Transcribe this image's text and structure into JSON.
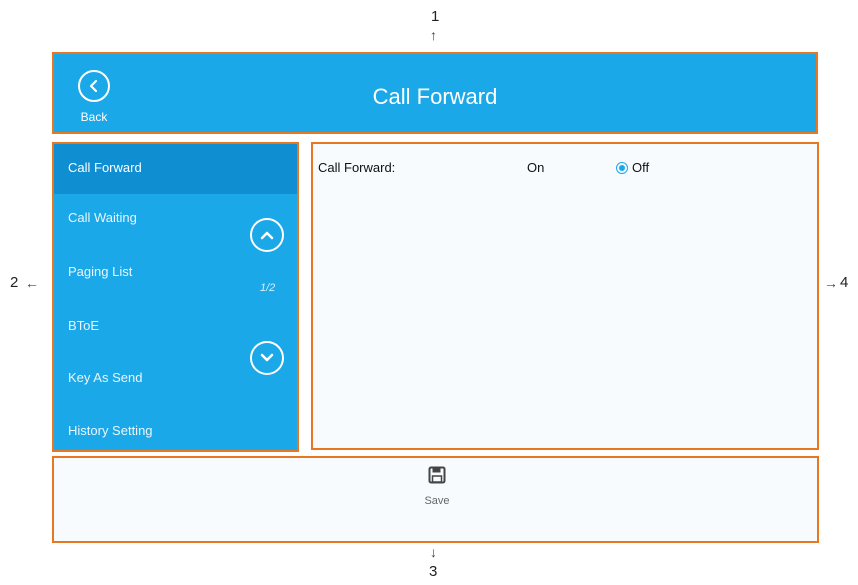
{
  "callouts": {
    "c1": "1",
    "c2": "2",
    "c3": "3",
    "c4": "4"
  },
  "header": {
    "back_label": "Back",
    "title": "Call Forward"
  },
  "sidebar": {
    "items": [
      {
        "label": "Call Forward",
        "active": true
      },
      {
        "label": "Call Waiting"
      },
      {
        "label": "Paging List"
      },
      {
        "label": "BToE"
      },
      {
        "label": "Key As Send"
      },
      {
        "label": "History Setting"
      }
    ],
    "page_indicator": "1/2"
  },
  "content": {
    "field_label": "Call Forward:",
    "option_on": "On",
    "option_off": "Off",
    "selected": "Off"
  },
  "footer": {
    "save_label": "Save"
  },
  "colors": {
    "accent": "#1aa8e8",
    "frame": "#e87722",
    "active_item": "#0f8fd2"
  }
}
